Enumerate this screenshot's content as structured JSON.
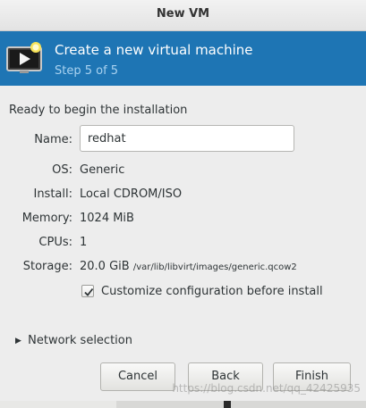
{
  "window": {
    "title": "New VM"
  },
  "banner": {
    "title": "Create a new virtual machine",
    "step": "Step 5 of 5",
    "icon": "vm-monitor-icon"
  },
  "summary": {
    "heading": "Ready to begin the installation",
    "name_label": "Name:",
    "name_value": "redhat",
    "os_label": "OS:",
    "os_value": "Generic",
    "install_label": "Install:",
    "install_value": "Local CDROM/ISO",
    "memory_label": "Memory:",
    "memory_value": "1024 MiB",
    "cpus_label": "CPUs:",
    "cpus_value": "1",
    "storage_label": "Storage:",
    "storage_size": "20.0 GiB",
    "storage_path": "/var/lib/libvirt/images/generic.qcow2"
  },
  "customize": {
    "label": "Customize configuration before install",
    "checked": true
  },
  "network": {
    "label": "Network selection",
    "expanded": false
  },
  "buttons": {
    "cancel": "Cancel",
    "back": "Back",
    "finish": "Finish"
  },
  "watermark": "https://blog.csdn.net/qq_42425935",
  "colors": {
    "banner_bg": "#1e75b4",
    "banner_step": "#a9d2f0",
    "window_bg": "#ededed"
  }
}
